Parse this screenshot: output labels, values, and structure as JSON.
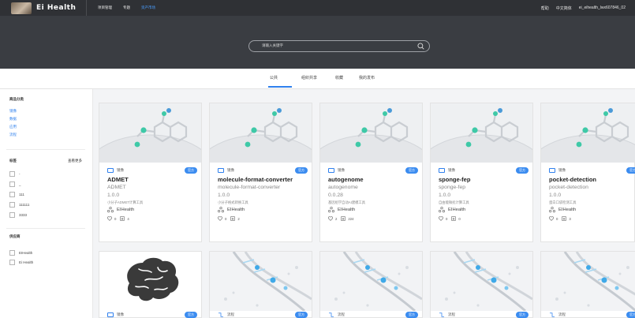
{
  "app": {
    "name": "Ei Health"
  },
  "nav": {
    "items": [
      "项目管理",
      "专题",
      "资产市场"
    ],
    "active_index": 2
  },
  "top_right": {
    "help": "帮助",
    "language": "中文简体",
    "username": "ei_eihealth_lwx607846_02"
  },
  "search": {
    "placeholder": "请输入关键字"
  },
  "tabs": {
    "items": [
      "公共",
      "组织共享",
      "收藏",
      "我的发布"
    ],
    "active_index": 0
  },
  "sidebar": {
    "category": {
      "title": "商品分类",
      "items": [
        "镜像",
        "数据",
        "应用",
        "流程"
      ]
    },
    "tags": {
      "title": "标签",
      "more": "查看更多",
      "items": [
        "-",
        "_",
        "111",
        "111111",
        "3333"
      ]
    },
    "supplier": {
      "title": "供应商",
      "items": [
        "EIHealth",
        "Ei Health"
      ]
    }
  },
  "cards": [
    {
      "type": "镜像",
      "badge": "官方",
      "name": "ADMET",
      "subname": "ADMET",
      "version": "1.0.0",
      "desc": "小分子ADMET计算工具",
      "author": "EIHealth",
      "likes": "0",
      "downloads": "4"
    },
    {
      "type": "镜像",
      "badge": "官方",
      "name": "molecule-format-converter",
      "subname": "molecule-format-converter",
      "version": "1.0.0",
      "desc": "小分子格式转换工具",
      "author": "EIHealth",
      "likes": "0",
      "downloads": "2"
    },
    {
      "type": "镜像",
      "badge": "官方",
      "name": "autogenome",
      "subname": "autogenome",
      "version": "0.0.28",
      "desc": "基因组学自动AI建模工具",
      "author": "EIHealth",
      "likes": "2",
      "downloads": "224"
    },
    {
      "type": "镜像",
      "badge": "官方",
      "name": "sponge-fep",
      "subname": "sponge-fep",
      "version": "1.0.0",
      "desc": "自由能微扰计算工具",
      "author": "EIHealth",
      "likes": "0",
      "downloads": "0"
    },
    {
      "type": "镜像",
      "badge": "官方",
      "name": "pocket-detection",
      "subname": "pocket-detection",
      "version": "1.0.0",
      "desc": "蛋白口袋检测工具",
      "author": "EIHealth",
      "likes": "0",
      "downloads": "3"
    },
    {
      "type": "镜像",
      "badge": "官方"
    },
    {
      "type": "流程",
      "badge": "官方"
    },
    {
      "type": "流程",
      "badge": "官方"
    },
    {
      "type": "流程",
      "badge": "官方"
    },
    {
      "type": "流程",
      "badge": "官方"
    }
  ],
  "colors": {
    "accent": "#2f80ed",
    "topbar": "#2f3135",
    "searchband": "#3a3d42",
    "badge": "#3b8cf0"
  }
}
